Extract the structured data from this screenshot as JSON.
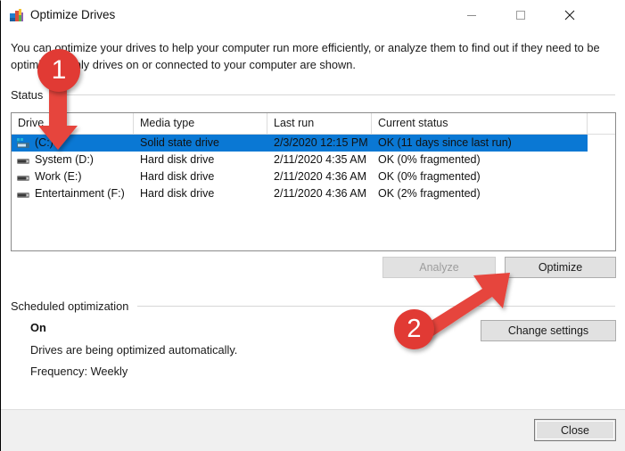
{
  "window": {
    "title": "Optimize Drives",
    "icon": "defrag-icon",
    "controls": {
      "minimize": "—",
      "maximize": "□",
      "close": "✕"
    }
  },
  "description": "You can optimize your drives to help your computer run more efficiently, or analyze them to find out if they need to be optimized. Only drives on or connected to your computer are shown.",
  "sections": {
    "status_label": "Status",
    "scheduled_label": "Scheduled optimization"
  },
  "drive_list": {
    "columns": [
      "Drive",
      "Media type",
      "Last run",
      "Current status"
    ],
    "rows": [
      {
        "drive": "(C:)",
        "media_type": "Solid state drive",
        "last_run": "2/3/2020 12:15 PM",
        "current_status": "OK (11 days since last run)",
        "icon": "ssd-drive-icon",
        "selected": true
      },
      {
        "drive": "System (D:)",
        "media_type": "Hard disk drive",
        "last_run": "2/11/2020 4:35 AM",
        "current_status": "OK (0% fragmented)",
        "icon": "hard-disk-icon",
        "selected": false
      },
      {
        "drive": "Work (E:)",
        "media_type": "Hard disk drive",
        "last_run": "2/11/2020 4:36 AM",
        "current_status": "OK (0% fragmented)",
        "icon": "hard-disk-icon",
        "selected": false
      },
      {
        "drive": "Entertainment (F:)",
        "media_type": "Hard disk drive",
        "last_run": "2/11/2020 4:36 AM",
        "current_status": "OK (2% fragmented)",
        "icon": "hard-disk-icon",
        "selected": false
      }
    ]
  },
  "buttons": {
    "analyze": "Analyze",
    "optimize": "Optimize",
    "change_settings": "Change settings",
    "close": "Close"
  },
  "scheduled": {
    "state": "On",
    "detail": "Drives are being optimized automatically.",
    "frequency": "Frequency: Weekly"
  },
  "annotations": [
    {
      "number": "1",
      "target": "drive-c-row"
    },
    {
      "number": "2",
      "target": "optimize-button"
    }
  ],
  "colors": {
    "selection_blue": "#0a78d4",
    "annotation_red": "#e13a34",
    "button_face": "#e1e1e1",
    "footer": "#f0f0f0"
  }
}
